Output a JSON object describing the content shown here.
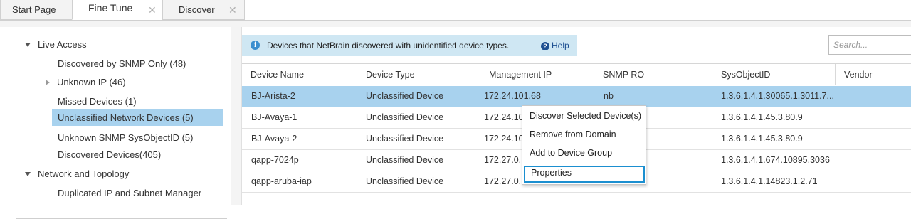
{
  "tabs": [
    {
      "label": "Start Page"
    },
    {
      "label": "Fine Tune",
      "close": "✕"
    },
    {
      "label": "Discover",
      "close": "✕"
    }
  ],
  "tree": {
    "live_access": "Live Access",
    "discovered_snmp": "Discovered by SNMP Only (48)",
    "unknown_ip": "Unknown IP (46)",
    "missed_devices": "Missed Devices (1)",
    "unclassified": "Unclassified Network Devices (5)",
    "unknown_snmp": "Unknown SNMP SysObjectID (5)",
    "discovered_devices": "Discovered Devices(405)",
    "network_topology": "Network and Topology",
    "duplicated_ip": "Duplicated IP and Subnet Manager"
  },
  "banner": {
    "text": "Devices that NetBrain discovered with unidentified device types.",
    "help": "Help"
  },
  "search": {
    "placeholder": "Search..."
  },
  "columns": [
    "Device Name",
    "Device Type",
    "Management IP",
    "SNMP RO",
    "SysObjectID",
    "Vendor"
  ],
  "rows": [
    {
      "name": "BJ-Arista-2",
      "type": "Unclassified Device",
      "ip": "172.24.101.68",
      "snmp": "nb",
      "oid": "1.3.6.1.4.1.30065.1.3011.7...",
      "vendor": ""
    },
    {
      "name": "BJ-Avaya-1",
      "type": "Unclassified Device",
      "ip": "172.24.10",
      "snmp": "",
      "oid": "1.3.6.1.4.1.45.3.80.9",
      "vendor": ""
    },
    {
      "name": "BJ-Avaya-2",
      "type": "Unclassified Device",
      "ip": "172.24.10",
      "snmp": "",
      "oid": "1.3.6.1.4.1.45.3.80.9",
      "vendor": ""
    },
    {
      "name": "qapp-7024p",
      "type": "Unclassified Device",
      "ip": "172.27.0.",
      "snmp": "",
      "oid": "1.3.6.1.4.1.674.10895.3036",
      "vendor": ""
    },
    {
      "name": "qapp-aruba-iap",
      "type": "Unclassified Device",
      "ip": "172.27.0.",
      "snmp": "",
      "oid": "1.3.6.1.4.1.14823.1.2.71",
      "vendor": ""
    }
  ],
  "context_menu": {
    "discover": "Discover Selected Device(s)",
    "remove": "Remove from Domain",
    "add_group": "Add to Device Group",
    "properties": "Properties"
  },
  "colors": {
    "selection": "#a8d2ee",
    "banner": "#cfe7f3",
    "highlight_border": "#1b8fd0"
  }
}
